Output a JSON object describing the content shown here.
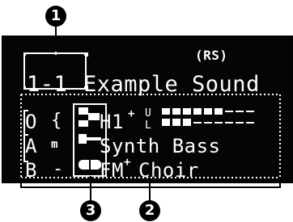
{
  "callouts": {
    "c1": "1",
    "c2": "2",
    "c3": "3"
  },
  "display": {
    "mode_tag": "(RS)",
    "program_number": "1-1",
    "program_name": "Example Sound",
    "parts": [
      {
        "letter": "O",
        "sym": "{",
        "name": "H1",
        "sup": "+",
        "sub_top": "U",
        "sub_bot": "L"
      },
      {
        "letter": "A",
        "sym": "m",
        "name": "Synth Bass"
      },
      {
        "letter": "B",
        "sym": "-",
        "name": "FM",
        "sup": "+",
        "name2": "Choir"
      }
    ]
  },
  "colors": {
    "lcd_bg": "#050505",
    "lcd_fg": "#ffffff",
    "callout_bg": "#000000"
  }
}
